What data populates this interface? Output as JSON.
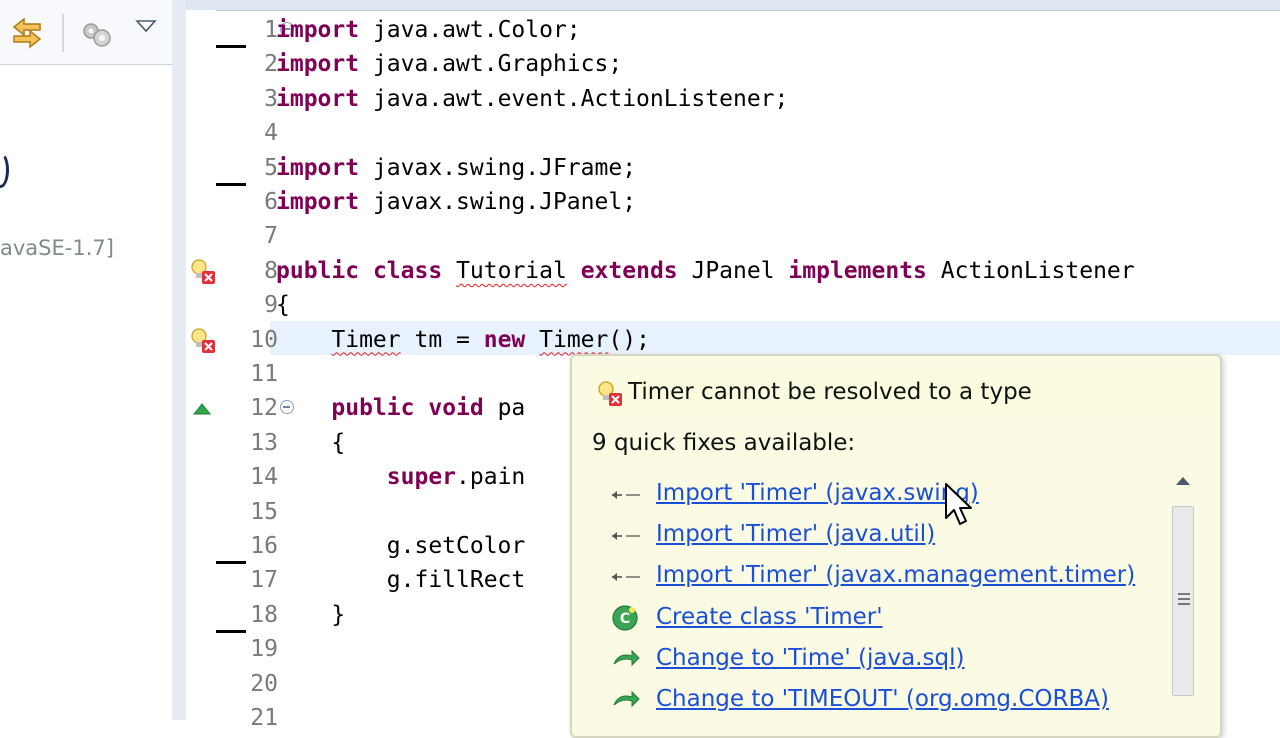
{
  "left_panel": {
    "jre_label": "avaSE-1.7]"
  },
  "editor": {
    "lines": [
      {
        "n": "1",
        "tokens": [
          {
            "t": "import",
            "k": "kw"
          },
          {
            "t": " java.awt.Color;"
          }
        ]
      },
      {
        "n": "2",
        "tokens": [
          {
            "t": "import",
            "k": "kw"
          },
          {
            "t": " java.awt.Graphics;"
          }
        ]
      },
      {
        "n": "3",
        "tokens": [
          {
            "t": "import",
            "k": "kw"
          },
          {
            "t": " java.awt.event.ActionListener;"
          }
        ]
      },
      {
        "n": "4",
        "tokens": []
      },
      {
        "n": "5",
        "tokens": [
          {
            "t": "import",
            "k": "kw"
          },
          {
            "t": " javax.swing.JFrame;"
          }
        ]
      },
      {
        "n": "6",
        "tokens": [
          {
            "t": "import",
            "k": "kw"
          },
          {
            "t": " javax.swing.JPanel;"
          }
        ]
      },
      {
        "n": "7",
        "tokens": []
      },
      {
        "n": "8",
        "tokens": [
          {
            "t": "public",
            "k": "kw"
          },
          {
            "t": " "
          },
          {
            "t": "class",
            "k": "kw"
          },
          {
            "t": " "
          },
          {
            "t": "Tutorial",
            "k": "err"
          },
          {
            "t": " "
          },
          {
            "t": "extends",
            "k": "kw"
          },
          {
            "t": " JPanel "
          },
          {
            "t": "implements",
            "k": "kw"
          },
          {
            "t": " ActionListener"
          }
        ]
      },
      {
        "n": "9",
        "tokens": [
          {
            "t": "{"
          }
        ]
      },
      {
        "n": "10",
        "tokens": [
          {
            "t": "    "
          },
          {
            "t": "Timer",
            "k": "err"
          },
          {
            "t": " tm = "
          },
          {
            "t": "new",
            "k": "kw"
          },
          {
            "t": " "
          },
          {
            "t": "Timer",
            "k": "err"
          },
          {
            "t": "();"
          }
        ]
      },
      {
        "n": "11",
        "tokens": []
      },
      {
        "n": "12",
        "tokens": [
          {
            "t": "    "
          },
          {
            "t": "public",
            "k": "kw"
          },
          {
            "t": " "
          },
          {
            "t": "void",
            "k": "kw"
          },
          {
            "t": " pa"
          }
        ]
      },
      {
        "n": "13",
        "tokens": [
          {
            "t": "    {"
          }
        ]
      },
      {
        "n": "14",
        "tokens": [
          {
            "t": "        "
          },
          {
            "t": "super",
            "k": "kw"
          },
          {
            "t": ".pain"
          }
        ]
      },
      {
        "n": "15",
        "tokens": []
      },
      {
        "n": "16",
        "tokens": [
          {
            "t": "        g.setColor"
          }
        ]
      },
      {
        "n": "17",
        "tokens": [
          {
            "t": "        g.fillRect"
          }
        ]
      },
      {
        "n": "18",
        "tokens": [
          {
            "t": "    }"
          }
        ]
      },
      {
        "n": "19",
        "tokens": []
      },
      {
        "n": "20",
        "tokens": []
      },
      {
        "n": "21",
        "tokens": []
      }
    ]
  },
  "quick_fix": {
    "title": "Timer cannot be resolved to a type",
    "subtitle": "9 quick fixes available:",
    "items": [
      {
        "label": "Import 'Timer' (javax.swing)",
        "icon": "import-icon"
      },
      {
        "label": "Import 'Timer' (java.util)",
        "icon": "import-icon"
      },
      {
        "label": "Import 'Timer' (javax.management.timer)",
        "icon": "import-icon"
      },
      {
        "label": "Create class 'Timer'",
        "icon": "new-class-icon"
      },
      {
        "label": "Change to 'Time' (java.sql)",
        "icon": "change-arrow-icon"
      },
      {
        "label": "Change to 'TIMEOUT' (org.omg.CORBA)",
        "icon": "change-arrow-icon"
      }
    ]
  },
  "colors": {
    "keyword": "#7f0055",
    "link": "#1a4fd8",
    "popup_bg": "#fbfbe3",
    "current_line": "#e8f2fe"
  }
}
